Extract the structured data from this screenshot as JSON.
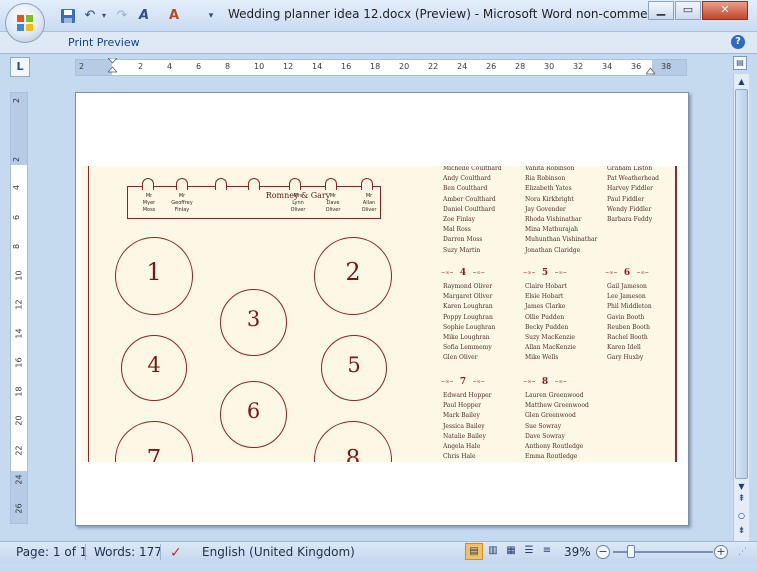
{
  "window": {
    "title": "Wedding planner idea 12.docx (Preview)  -  Microsoft Word non-commerci...",
    "minimize": "▁",
    "restore": "▭",
    "close": "✕"
  },
  "qat": {
    "save_icon": "save-icon",
    "undo_icon": "undo-icon",
    "redo_icon": "redo-icon",
    "customize": "▾"
  },
  "ribbon": {
    "tab": "Print Preview",
    "help": "?"
  },
  "ruler": {
    "h": [
      "2",
      "2",
      "4",
      "6",
      "8",
      "10",
      "12",
      "14",
      "16",
      "18",
      "20",
      "22",
      "24",
      "26",
      "28",
      "30",
      "32",
      "34",
      "36",
      "38"
    ],
    "v": [
      "2",
      "2",
      "4",
      "6",
      "8",
      "10",
      "12",
      "14",
      "16",
      "18",
      "20",
      "22",
      "24",
      "26"
    ]
  },
  "card": {
    "couple": "Romney & Gary",
    "head_guests": [
      "Mr\nMyer\nMoss",
      "Mr\nGeoffrey\nFinlay",
      "Mrs\nLynn\nOliver",
      "Mr\nDave\nOliver",
      "Mr\nAllan\nOliver"
    ],
    "tables": [
      "1",
      "2",
      "3",
      "4",
      "5",
      "6",
      "7",
      "8"
    ],
    "list_col1_top": [
      "Michelle Coulthard",
      "Andy Coulthard",
      "Ben Coulthard",
      "Amber Coulthard",
      "Daniel Coulthard",
      "Zoe Finlay",
      "Mal Ross",
      "Darren Moss",
      "Suzy Martin"
    ],
    "list_col2_top": [
      "Vanita Robinson",
      "Ria Robinson",
      "Elizabeth Yates",
      "Nora Kirkbright",
      "Jay Govender",
      "Rhoda Vishinathar",
      "Mina Mathurajah",
      "Muhunthan Vishinathar",
      "Jonathan Claridge"
    ],
    "list_col3_top": [
      "Graham Liston",
      "Pat Weatherhead",
      "Harvey Fiddler",
      "Paul Fiddler",
      "Wendy Fiddler",
      "Barbara Feddy"
    ],
    "table4_label": "4",
    "table4": [
      "Raymond Oliver",
      "Margaret Oliver",
      "Karen Loughran",
      "Poppy Loughran",
      "Sophie Loughran",
      "Mike Loughran",
      "Sofia Lemmemy",
      "Glen Oliver"
    ],
    "table5_label": "5",
    "table5": [
      "Claire Hobart",
      "Elsie Hobart",
      "James Clarke",
      "Ollie Pudden",
      "Becky Pudden",
      "Suzy MacKenzie",
      "Allan MacKenzie",
      "Mike Wells"
    ],
    "table6_label": "6",
    "table6": [
      "Gail Jameson",
      "Lee Jameson",
      "Phil Middleton",
      "Gavin Booth",
      "Reuben Booth",
      "Rachel Booth",
      "Karen Idell",
      "Gary Huxby"
    ],
    "table7_label": "7",
    "table7": [
      "Edward Hopper",
      "Paul Hopper",
      "Mark Bailey",
      "Jessica Bailey",
      "Natalie Bailey",
      "Angela Hale",
      "Chris Hale"
    ],
    "table8_label": "8",
    "table8": [
      "Lauren Greenwood",
      "Matthew Greenwood",
      "Glen Greenwood",
      "Sue Sowray",
      "Dave Sowray",
      "Anthony Routledge",
      "Emma Routledge"
    ]
  },
  "status": {
    "page": "Page: 1 of 1",
    "words": "Words: 177",
    "language": "English (United Kingdom)",
    "zoom": "39%",
    "zoom_minus": "−",
    "zoom_plus": "+"
  }
}
